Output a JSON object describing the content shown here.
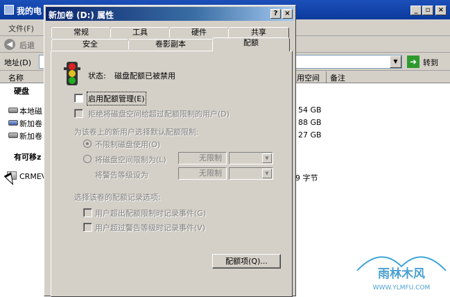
{
  "explorer": {
    "title": "我的电",
    "menu_file": "文件(F)",
    "back_label": "后退",
    "address_label": "地址(D)",
    "go_label": "转到",
    "columns": [
      "名称",
      "用空间",
      "备注"
    ],
    "section_hdd": "硬盘",
    "drives": [
      {
        "name": "本地磁",
        "free": "54 GB"
      },
      {
        "name": "新加卷",
        "free": "88 GB"
      },
      {
        "name": "新加卷",
        "free": "27 GB"
      }
    ],
    "section_removable": "有可移z",
    "removable": [
      {
        "name": "CRMEVC",
        "free": "9 字节"
      }
    ]
  },
  "dialog": {
    "title": "新加卷 (D:) 属性",
    "help_btn": "?",
    "close_btn": "×",
    "tabs_row1": [
      "常规",
      "工具",
      "硬件",
      "共享"
    ],
    "tabs_row2": [
      "安全",
      "卷影副本",
      "配额"
    ],
    "active_tab": "配额",
    "status_label": "状态:",
    "status_value": "磁盘配额已被禁用",
    "enable_quota": "启用配额管理(E)",
    "deny_space": "拒绝将磁盘空间给超过配额限制的用户(D)",
    "default_limit_heading": "为该卷上的新用户选择默认配额限制:",
    "no_limit": "不限制磁盘使用(O)",
    "limit_to": "将磁盘空间限制为(L)",
    "limit_value": "无限制",
    "warning_level": "将警告等级设为",
    "warning_value": "无限制",
    "logging_heading": "选择该卷的配额记录选项:",
    "log_exceed_limit": "用户超出配额限制时记录事件(G)",
    "log_exceed_warning": "用户超过警告等级时记录事件(V)",
    "quota_entries_button": "配额项(Q)..."
  },
  "watermark": {
    "text": "雨林木风",
    "url": "WWW.YLMFU.COM"
  }
}
